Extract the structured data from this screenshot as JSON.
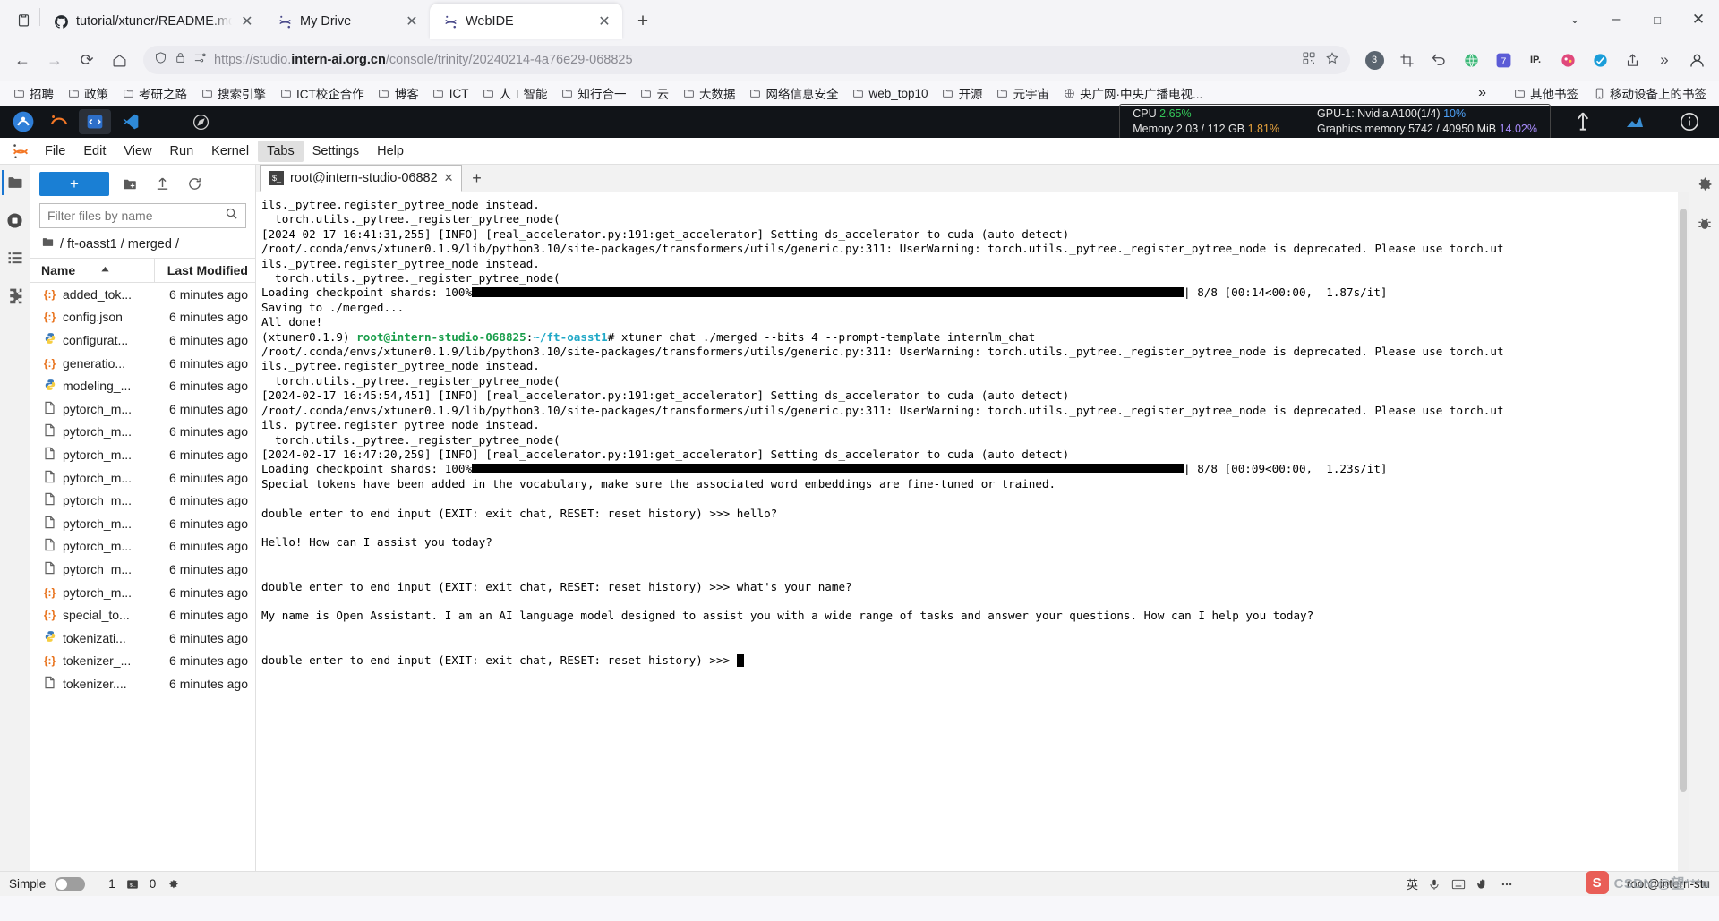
{
  "browser": {
    "tabs": [
      {
        "title": "tutorial/xtuner/README.md a",
        "favicon": "github-icon",
        "active": false
      },
      {
        "title": "My Drive",
        "favicon": "jupyter-icon",
        "active": false
      },
      {
        "title": "WebIDE",
        "favicon": "jupyter-icon",
        "active": true
      }
    ],
    "newtab_label": "+",
    "window_controls": {
      "minimize": "–",
      "maximize": "□",
      "close": "✕",
      "more": "⌄"
    },
    "nav": {
      "back": "←",
      "forward": "→",
      "reload": "⟳",
      "home": "⌂"
    },
    "url": {
      "scheme": "https://",
      "sub": "studio.",
      "domain": "intern-ai.org.cn",
      "path": "/console/trinity/20240214-4a76e29-068825"
    },
    "omnibox_icons": [
      "shield-icon",
      "lock-icon",
      "tune-icon",
      "qr-icon",
      "star-icon"
    ],
    "toolbar_right": [
      "extensions-badge-3",
      "crop-icon",
      "undo-icon",
      "globe-icon",
      "translate-icon",
      "ip-icon",
      "palette-icon",
      "blue-circle-icon",
      "share-icon",
      "chevron-double-right-icon",
      "profile-icon"
    ],
    "extension_badge": "3",
    "ip_label": "IP.",
    "bookmarks": [
      {
        "label": "招聘",
        "icon": "folder-icon"
      },
      {
        "label": "政策",
        "icon": "folder-icon"
      },
      {
        "label": "考研之路",
        "icon": "folder-icon"
      },
      {
        "label": "搜索引擎",
        "icon": "folder-icon"
      },
      {
        "label": "ICT校企合作",
        "icon": "folder-icon"
      },
      {
        "label": "博客",
        "icon": "folder-icon"
      },
      {
        "label": "ICT",
        "icon": "folder-icon"
      },
      {
        "label": "人工智能",
        "icon": "folder-icon"
      },
      {
        "label": "知行合一",
        "icon": "folder-icon"
      },
      {
        "label": "云",
        "icon": "folder-icon"
      },
      {
        "label": "大数据",
        "icon": "folder-icon"
      },
      {
        "label": "网络信息安全",
        "icon": "folder-icon"
      },
      {
        "label": "web_top10",
        "icon": "folder-icon"
      },
      {
        "label": "开源",
        "icon": "folder-icon"
      },
      {
        "label": "元宇宙",
        "icon": "folder-icon"
      },
      {
        "label": "央广网·中央广播电视...",
        "icon": "globe-icon"
      }
    ],
    "bookmarks_overflow": "»",
    "bookmarks_other": "其他书签",
    "bookmarks_mobile": "移动设备上的书签"
  },
  "jupyter": {
    "toolbar_icons": [
      "jupyter-logo-icon",
      "xtuner-logo-icon",
      "vscode-blue-icon",
      "vscode-icon",
      "compass-icon"
    ],
    "resources": {
      "cpu_label": "CPU",
      "cpu_value": "2.65%",
      "gpu_label": "GPU-1: Nvidia A100(1/4)",
      "gpu_value": "10%",
      "memory_label": "Memory 2.03 / 112 GB",
      "memory_value": "1.81%",
      "gmem_label": "Graphics memory 5742 / 40950 MiB",
      "gmem_value": "14.02%"
    },
    "menu": [
      "File",
      "Edit",
      "View",
      "Run",
      "Kernel",
      "Tabs",
      "Settings",
      "Help"
    ],
    "menu_active": "Tabs",
    "left_rail": [
      "folder-icon",
      "stop-circle-icon",
      "list-icon",
      "puzzle-icon"
    ],
    "right_rail": [
      "gear-icon",
      "bug-icon"
    ],
    "filebrowser": {
      "new_label": "+",
      "toolbar_icons": [
        "new-folder-icon",
        "upload-icon",
        "refresh-icon"
      ],
      "filter_placeholder": "Filter files by name",
      "search_icon": "search-icon",
      "breadcrumb": "/ ft-oasst1 / merged /",
      "columns": {
        "name": "Name",
        "modified": "Last Modified"
      },
      "sort_icon": "sort-asc-icon",
      "files": [
        {
          "name": "added_tok...",
          "type": "json",
          "modified": "6 minutes ago"
        },
        {
          "name": "config.json",
          "type": "json",
          "modified": "6 minutes ago"
        },
        {
          "name": "configurat...",
          "type": "py",
          "modified": "6 minutes ago"
        },
        {
          "name": "generatio...",
          "type": "json",
          "modified": "6 minutes ago"
        },
        {
          "name": "modeling_...",
          "type": "py",
          "modified": "6 minutes ago"
        },
        {
          "name": "pytorch_m...",
          "type": "bin",
          "modified": "6 minutes ago"
        },
        {
          "name": "pytorch_m...",
          "type": "bin",
          "modified": "6 minutes ago"
        },
        {
          "name": "pytorch_m...",
          "type": "bin",
          "modified": "6 minutes ago"
        },
        {
          "name": "pytorch_m...",
          "type": "bin",
          "modified": "6 minutes ago"
        },
        {
          "name": "pytorch_m...",
          "type": "bin",
          "modified": "6 minutes ago"
        },
        {
          "name": "pytorch_m...",
          "type": "bin",
          "modified": "6 minutes ago"
        },
        {
          "name": "pytorch_m...",
          "type": "bin",
          "modified": "6 minutes ago"
        },
        {
          "name": "pytorch_m...",
          "type": "bin",
          "modified": "6 minutes ago"
        },
        {
          "name": "pytorch_m...",
          "type": "json",
          "modified": "6 minutes ago"
        },
        {
          "name": "special_to...",
          "type": "json",
          "modified": "6 minutes ago"
        },
        {
          "name": "tokenizati...",
          "type": "py",
          "modified": "6 minutes ago"
        },
        {
          "name": "tokenizer_...",
          "type": "json",
          "modified": "6 minutes ago"
        },
        {
          "name": "tokenizer....",
          "type": "bin",
          "modified": "6 minutes ago"
        }
      ]
    },
    "terminal_tab": {
      "label": "root@intern-studio-06882",
      "close": "✕",
      "add": "+"
    },
    "status": {
      "mode_label": "Simple",
      "tab_count": "1",
      "terminal_count": "0",
      "terminal_icon": "terminal-icon",
      "gear_icon": "gear-icon",
      "user": "root@intern-stu"
    }
  },
  "terminal": {
    "lines": [
      {
        "t": "ils._pytree.register_pytree_node instead."
      },
      {
        "t": "  torch.utils._pytree._register_pytree_node("
      },
      {
        "t": "[2024-02-17 16:41:31,255] [INFO] [real_accelerator.py:191:get_accelerator] Setting ds_accelerator to cuda (auto detect)"
      },
      {
        "t": "/root/.conda/envs/xtuner0.1.9/lib/python3.10/site-packages/transformers/utils/generic.py:311: UserWarning: torch.utils._pytree._register_pytree_node is deprecated. Please use torch.ut"
      },
      {
        "t": "ils._pytree.register_pytree_node instead."
      },
      {
        "t": "  torch.utils._pytree._register_pytree_node("
      },
      {
        "t": "PROGRESS1"
      },
      {
        "t": "Saving to ./merged..."
      },
      {
        "t": "All done!"
      },
      {
        "t": "PROMPT"
      },
      {
        "t": "/root/.conda/envs/xtuner0.1.9/lib/python3.10/site-packages/transformers/utils/generic.py:311: UserWarning: torch.utils._pytree._register_pytree_node is deprecated. Please use torch.ut"
      },
      {
        "t": "ils._pytree.register_pytree_node instead."
      },
      {
        "t": "  torch.utils._pytree._register_pytree_node("
      },
      {
        "t": "[2024-02-17 16:45:54,451] [INFO] [real_accelerator.py:191:get_accelerator] Setting ds_accelerator to cuda (auto detect)"
      },
      {
        "t": "/root/.conda/envs/xtuner0.1.9/lib/python3.10/site-packages/transformers/utils/generic.py:311: UserWarning: torch.utils._pytree._register_pytree_node is deprecated. Please use torch.ut"
      },
      {
        "t": "ils._pytree.register_pytree_node instead."
      },
      {
        "t": "  torch.utils._pytree._register_pytree_node("
      },
      {
        "t": "[2024-02-17 16:47:20,259] [INFO] [real_accelerator.py:191:get_accelerator] Setting ds_accelerator to cuda (auto detect)"
      },
      {
        "t": "PROGRESS2"
      },
      {
        "t": "Special tokens have been added in the vocabulary, make sure the associated word embeddings are fine-tuned or trained."
      },
      {
        "t": ""
      },
      {
        "t": "double enter to end input (EXIT: exit chat, RESET: reset history) >>> hello?"
      },
      {
        "t": ""
      },
      {
        "t": "Hello! How can I assist you today?"
      },
      {
        "t": ""
      },
      {
        "t": ""
      },
      {
        "t": "double enter to end input (EXIT: exit chat, RESET: reset history) >>> what's your name?"
      },
      {
        "t": ""
      },
      {
        "t": "My name is Open Assistant. I am an AI language model designed to assist you with a wide range of tasks and answer your questions. How can I help you today?"
      },
      {
        "t": ""
      },
      {
        "t": ""
      },
      {
        "t": "CURSORLINE"
      }
    ],
    "progress1": {
      "prefix": "Loading checkpoint shards: 100%",
      "suffix": "| 8/8 [00:14<00:00,  1.87s/it]"
    },
    "progress2": {
      "prefix": "Loading checkpoint shards: 100%",
      "suffix": "| 8/8 [00:09<00:00,  1.23s/it]"
    },
    "prompt": {
      "env": "(xtuner0.1.9) ",
      "user_host": "root@intern-studio-068825",
      "colon": ":",
      "path": "~/ft-oasst1",
      "hash": "# ",
      "command": "xtuner chat ./merged --bits 4 --prompt-template internlm_chat"
    },
    "cursor_line": {
      "text": "double enter to end input (EXIT: exit chat, RESET: reset history) >>> "
    }
  },
  "watermark": {
    "badge": "S",
    "text": "CSDN @望***u"
  },
  "ime": {
    "lang": "英",
    "items": [
      "mic-icon",
      "keyboard-icon",
      "hand-icon",
      "more-icon"
    ]
  },
  "colors": {
    "accent": "#1a7fd4",
    "terminal_green": "#1a9e4b",
    "terminal_cyan": "#1fa8c7",
    "jl_header_bg": "#111418"
  }
}
